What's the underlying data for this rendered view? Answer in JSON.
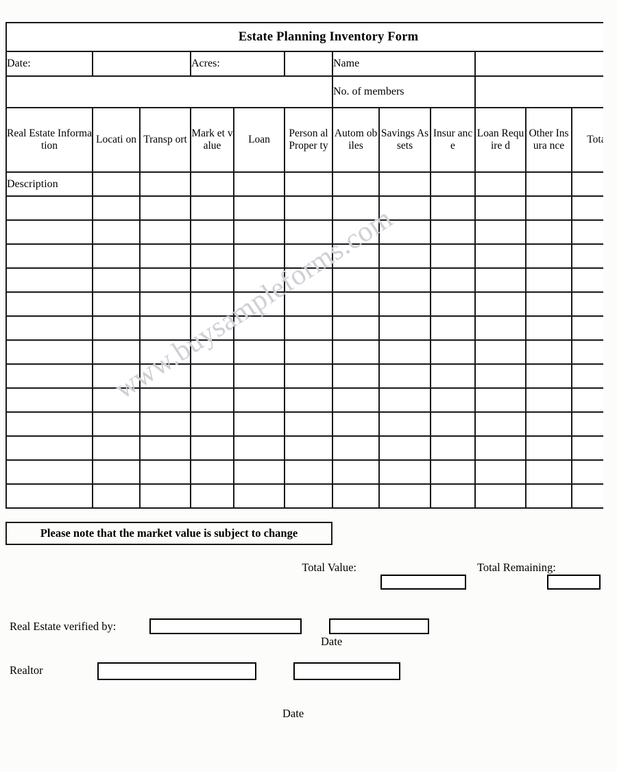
{
  "document": {
    "title": "Estate Planning Inventory Form"
  },
  "info_row": {
    "date_label": "Date:",
    "date_value": "",
    "acres_label": "Acres:",
    "acres_value": "",
    "name_label": "Name",
    "name_value": "",
    "blank_wide_value": "",
    "members_label": "No. of members",
    "members_value": ""
  },
  "table": {
    "headers": [
      "Real Estate Information",
      "Locati on",
      "Transp ort",
      "Mark et value",
      "Loan",
      "Person al Proper ty",
      "Autom obiles",
      "Savings Assets",
      "Insur ance",
      "Loan Require d",
      "Other Insura nce",
      "Total Value"
    ],
    "first_row_label": "Description",
    "blank_row_count": 13,
    "cell_value": ""
  },
  "note": {
    "text": "Please note that the market value is subject to change"
  },
  "totals": {
    "total_value_label": "Total Value:",
    "total_value": "",
    "total_remaining_label": "Total Remaining:",
    "total_remaining": ""
  },
  "signatures": {
    "verified_by_label": "Real Estate verified by:",
    "verified_by_value": "",
    "verified_date_value": "",
    "verified_date_label": "Date",
    "realtor_label": "Realtor",
    "realtor_value": "",
    "realtor_date_value": "",
    "realtor_date_label": "Date"
  },
  "watermark": {
    "text": "www.buysampleforms.com"
  },
  "colors": {
    "title_bar": "#b8cbe3",
    "column_header": "#dde9ef",
    "border": "#17181c",
    "watermark": "#cfcfd4",
    "page_background": "#fcfdfa"
  }
}
